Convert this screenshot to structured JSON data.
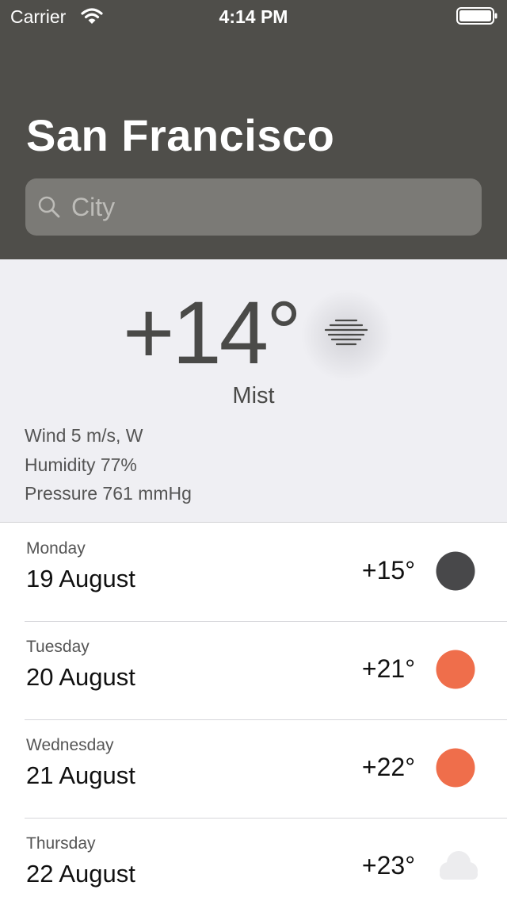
{
  "status_bar": {
    "carrier": "Carrier",
    "time": "4:14 PM",
    "icons": [
      "wifi-icon",
      "battery-icon"
    ]
  },
  "header": {
    "city": "San Francisco",
    "search": {
      "placeholder": "City",
      "value": ""
    }
  },
  "current": {
    "temperature": "+14°",
    "condition": "Mist",
    "icon": "mist-icon",
    "wind": "Wind 5 m/s, W",
    "humidity": "Humidity 77%",
    "pressure": "Pressure 761 mmHg"
  },
  "forecast": [
    {
      "weekday": "Monday",
      "date": "19 August",
      "temp": "+15°",
      "icon": "dark-circle-icon",
      "icon_color": "#48484a"
    },
    {
      "weekday": "Tuesday",
      "date": "20 August",
      "temp": "+21°",
      "icon": "sun-icon",
      "icon_color": "#ef6e4b"
    },
    {
      "weekday": "Wednesday",
      "date": "21 August",
      "temp": "+22°",
      "icon": "sun-icon",
      "icon_color": "#ef6e4b"
    },
    {
      "weekday": "Thursday",
      "date": "22 August",
      "temp": "+23°",
      "icon": "cloud-icon",
      "icon_color": "#ececee"
    }
  ],
  "colors": {
    "header_bg": "#4f4e4a",
    "search_bg": "#7b7a76",
    "current_bg": "#efeff3",
    "sun": "#ef6e4b"
  }
}
